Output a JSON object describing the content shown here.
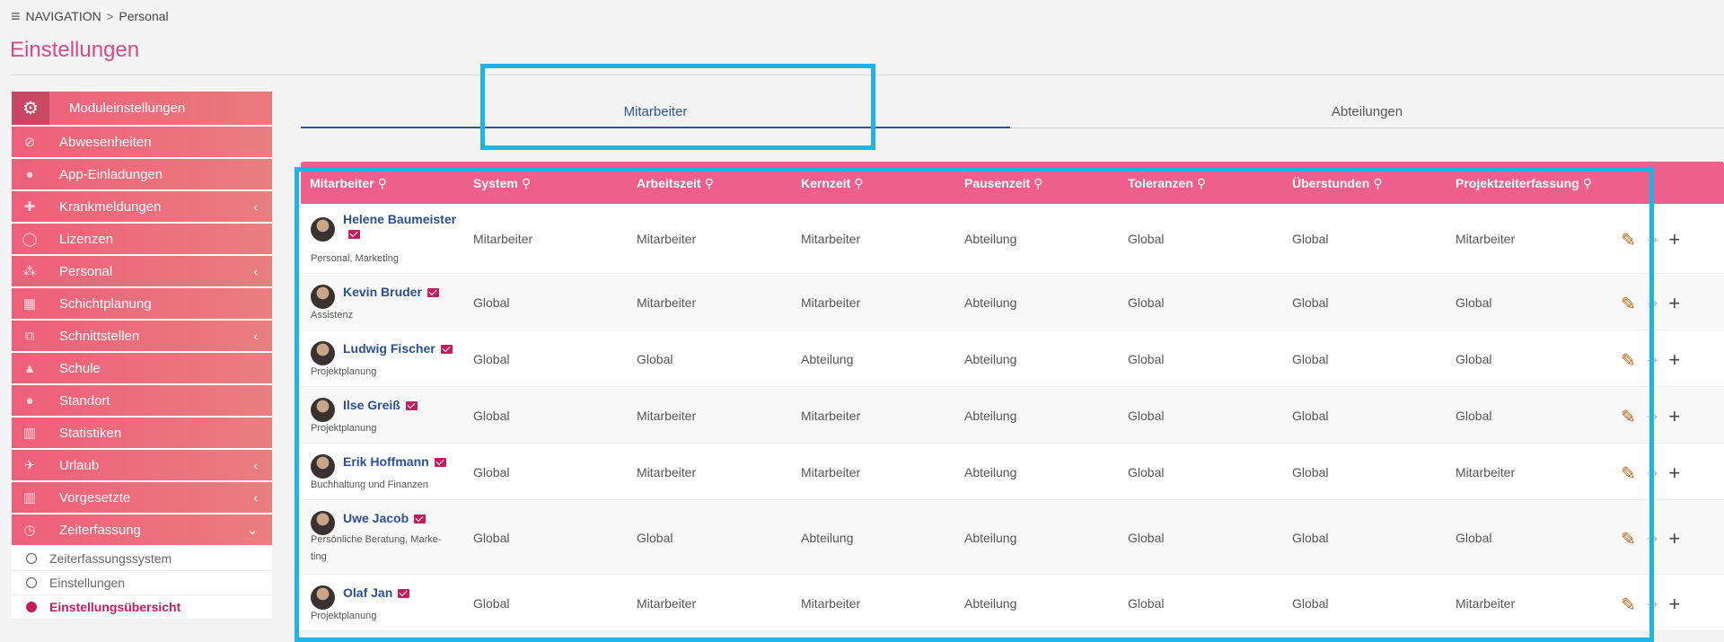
{
  "breadcrumb": {
    "root": "NAVIGATION",
    "separator": ">",
    "current": "Personal"
  },
  "page_title": "Einstellungen",
  "sidebar": {
    "header": "Moduleinstellungen",
    "items": [
      {
        "label": "Abwesenheiten",
        "icon": "ban-icon",
        "glyph": "⊘",
        "expandable": false
      },
      {
        "label": "App-Einladungen",
        "icon": "user-icon",
        "glyph": "●",
        "expandable": false
      },
      {
        "label": "Krankmeldungen",
        "icon": "medkit-icon",
        "glyph": "✚",
        "expandable": true
      },
      {
        "label": "Lizenzen",
        "icon": "circle-icon",
        "glyph": "◯",
        "expandable": false
      },
      {
        "label": "Personal",
        "icon": "users-icon",
        "glyph": "⁂",
        "expandable": true
      },
      {
        "label": "Schichtplanung",
        "icon": "calendar-icon",
        "glyph": "▦",
        "expandable": false
      },
      {
        "label": "Schnittstellen",
        "icon": "sitemap-icon",
        "glyph": "⧉",
        "expandable": true
      },
      {
        "label": "Schule",
        "icon": "graduation-cap-icon",
        "glyph": "▲",
        "expandable": false
      },
      {
        "label": "Standort",
        "icon": "map-marker-icon",
        "glyph": "●",
        "expandable": false
      },
      {
        "label": "Statistiken",
        "icon": "chart-icon",
        "glyph": "▥",
        "expandable": false
      },
      {
        "label": "Urlaub",
        "icon": "plane-icon",
        "glyph": "✈",
        "expandable": true
      },
      {
        "label": "Vorgesetzte",
        "icon": "chart-icon",
        "glyph": "▥",
        "expandable": true
      },
      {
        "label": "Zeiterfassung",
        "icon": "clock-icon",
        "glyph": "◷",
        "expandable": true,
        "expanded": true
      }
    ],
    "subitems": [
      {
        "label": "Zeiterfassungssystem",
        "active": false
      },
      {
        "label": "Einstellungen",
        "active": false
      },
      {
        "label": "Einstellungsübersicht",
        "active": true
      }
    ]
  },
  "tabs": [
    {
      "label": "Mitarbeiter",
      "active": true
    },
    {
      "label": "Abteilungen",
      "active": false
    }
  ],
  "table": {
    "columns": [
      "Mitarbeiter",
      "System",
      "Arbeitszeit",
      "Kernzeit",
      "Pausenzeit",
      "Toleranzen",
      "Überstunden",
      "Projektzeiterfassung"
    ],
    "rows": [
      {
        "name": "Helene Baumeister",
        "dept": "Personal, Marketing",
        "values": [
          "Mitarbeiter",
          "Mitarbeiter",
          "Mitarbeiter",
          "Abteilung",
          "Global",
          "Global",
          "Mitarbeiter"
        ]
      },
      {
        "name": "Kevin Bruder",
        "dept": "Assistenz",
        "values": [
          "Global",
          "Mitarbeiter",
          "Mitarbeiter",
          "Abteilung",
          "Global",
          "Global",
          "Global"
        ]
      },
      {
        "name": "Ludwig Fischer",
        "dept": "Projektplanung",
        "values": [
          "Global",
          "Global",
          "Abteilung",
          "Abteilung",
          "Global",
          "Global",
          "Global"
        ]
      },
      {
        "name": "Ilse Greiß",
        "dept": "Projektplanung",
        "values": [
          "Global",
          "Mitarbeiter",
          "Mitarbeiter",
          "Abteilung",
          "Global",
          "Global",
          "Global"
        ]
      },
      {
        "name": "Erik Hoffmann",
        "dept": "Buchhaltung und Finanzen",
        "values": [
          "Global",
          "Mitarbeiter",
          "Mitarbeiter",
          "Abteilung",
          "Global",
          "Global",
          "Mitarbeiter"
        ]
      },
      {
        "name": "Uwe Jacob",
        "dept": "Persönliche Beratung, Marke-",
        "dept2": "ting",
        "values": [
          "Global",
          "Global",
          "Abteilung",
          "Abteilung",
          "Global",
          "Global",
          "Global"
        ]
      },
      {
        "name": "Olaf Jan",
        "dept": "Projektplanung",
        "values": [
          "Global",
          "Mitarbeiter",
          "Mitarbeiter",
          "Abteilung",
          "Global",
          "Global",
          "Mitarbeiter"
        ]
      }
    ]
  },
  "colors": {
    "accent": "#d64b83",
    "sidebar": "#ee5f79",
    "table_header": "#ee5f8e",
    "highlight": "#1eb4e6",
    "link": "#2b4f93"
  }
}
